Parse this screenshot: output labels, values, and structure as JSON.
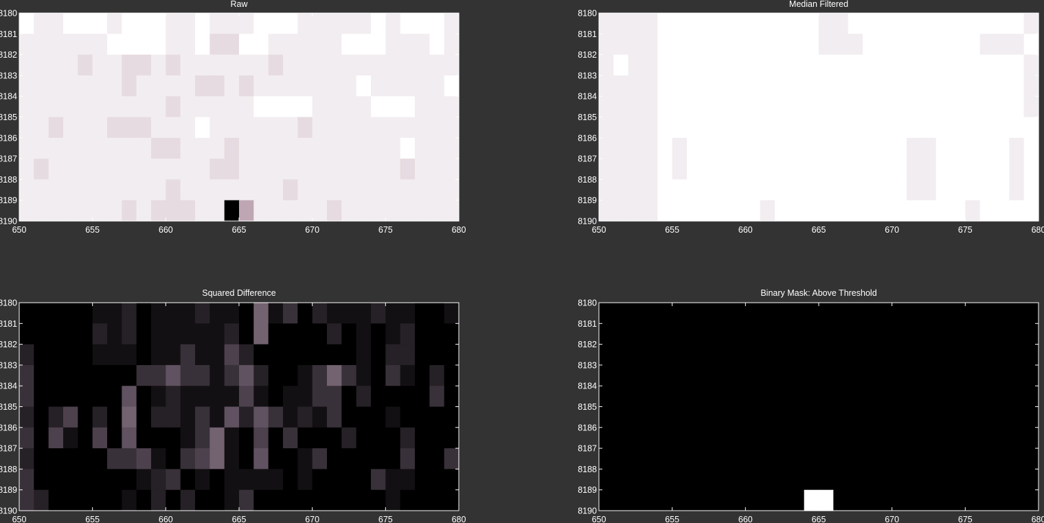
{
  "figure": {
    "background": "#333333",
    "colormaps": {
      "bone": [
        [
          0,
          0,
          0
        ],
        [
          0.375,
          0.32,
          0.375
        ],
        [
          0.75,
          0.65,
          0.7
        ],
        [
          1,
          1,
          1
        ]
      ],
      "gray": [
        [
          0,
          0,
          0
        ],
        [
          1,
          1,
          1
        ]
      ]
    }
  },
  "chart_data": [
    {
      "type": "heatmap",
      "title": "Raw",
      "colormap": "bone",
      "xlim": [
        650,
        680
      ],
      "ylim": [
        8190,
        8180
      ],
      "x_ticks": [
        "650",
        "655",
        "660",
        "665",
        "670",
        "675",
        "680"
      ],
      "y_ticks": [
        "8180",
        "8181",
        "8182",
        "8183",
        "8184",
        "8185",
        "8186",
        "8187",
        "8188",
        "8189",
        "8190"
      ],
      "x_start": 650,
      "y_start": 8180,
      "rows": [
        "FEEFFFEFFFEEFEEEFFFEEEEEFEFFFE",
        "EEEEEEFFFFEEFDDFFEEEEEFFFEEEFE",
        "EEEEDEEDDEDEEEEEEDEEEEEEEEEEEE",
        "EEEEEEEDEEEEDDEDEEEEEEEFEEEEEF",
        "EEEEEEEEEEDEEEEEFFFFEEEEFFFEEE",
        "EEDEEEDDDEEEFEEEEEEDEEEEEEEEEE",
        "EEEEEEEEEDDEEEDEEEEEEEEEEEFEEE",
        "EDEEEEEEEEEEEDDEEEEEEEEEEEDEEE",
        "EEEEEEEEEEDEEEEEEEDEEEEEEEEEEE",
        "EEEEEEEDEDDDEEIAEEEEEDEEEEEEEE"
      ]
    },
    {
      "type": "heatmap",
      "title": "Median Filtered",
      "colormap": "bone",
      "xlim": [
        650,
        680
      ],
      "ylim": [
        8190,
        8180
      ],
      "x_ticks": [
        "650",
        "655",
        "660",
        "665",
        "670",
        "675",
        "680"
      ],
      "y_ticks": [
        "8180",
        "8181",
        "8182",
        "8183",
        "8184",
        "8185",
        "8186",
        "8187",
        "8188",
        "8189",
        "8190"
      ],
      "x_start": 650,
      "y_start": 8180,
      "rows": [
        "EEEEFFFFFFFFFFFEEFFFFFFFFFFFFE",
        "EEEEFFFFFFFFFFFEEEFFFFFFFFEEEF",
        "EFEEFFFFFFFFFFFFFFFFFFFFFFFFFE",
        "EEEEFFFFFFFFFFFFFFFFFFFFFFFFFE",
        "EEEEFFFFFFFFFFFFFFFFFFFFFFFFFE",
        "EEEEFFFFFFFFFFFFFFFFFFFFFFFFFF",
        "EEEEFEFFFFFFFFFFFFFFFEEFFFFFEF",
        "EEEEFEFFFFFFFFFFFFFFFEEFFFFFEF",
        "EEEEFFFFFFFFFFFFFFFFFEEFFFFFEF",
        "EEEEFFFFFFFEFFFFFFFFFFFFFEFFFF"
      ]
    },
    {
      "type": "heatmap",
      "title": "Squared Difference",
      "colormap": "bone",
      "xlim": [
        650,
        680
      ],
      "ylim": [
        8190,
        8180
      ],
      "x_ticks": [
        "650",
        "655",
        "660",
        "665",
        "670",
        "675",
        "680"
      ],
      "y_ticks": [
        "8180",
        "8181",
        "8182",
        "8183",
        "8184",
        "8185",
        "8186",
        "8187",
        "8188",
        "8189",
        "8190"
      ],
      "x_start": 650,
      "y_start": 8180,
      "rows": [
        "000001120111211061302111211001",
        "000002120111112060000201012000",
        "200001110113114200000001022000",
        "300000003353313520013631031020",
        "300000050121111410113302000030",
        "202402060221315253121300010000",
        "304104050001361040300020002000",
        "200000334103461050013000003003",
        "300000001230101111010000311000",
        "320000010202001300000000010000"
      ]
    },
    {
      "type": "heatmap",
      "title": "Binary Mask: Above Threshold",
      "colormap": "gray",
      "xlim": [
        650,
        680
      ],
      "ylim": [
        8190,
        8180
      ],
      "x_ticks": [
        "650",
        "655",
        "660",
        "665",
        "670",
        "675",
        "680"
      ],
      "y_ticks": [
        "8180",
        "8181",
        "8182",
        "8183",
        "8184",
        "8185",
        "8186",
        "8187",
        "8188",
        "8189",
        "8190"
      ],
      "x_start": 650,
      "y_start": 8180,
      "rows": [
        "000000000000000000000000000000",
        "000000000000000000000000000000",
        "000000000000000000000000000000",
        "000000000000000000000000000000",
        "000000000000000000000000000000",
        "000000000000000000000000000000",
        "000000000000000000000000000000",
        "000000000000000000000000000000",
        "000000000000000000000000000000",
        "00000000000000FF00000000000000"
      ]
    }
  ]
}
